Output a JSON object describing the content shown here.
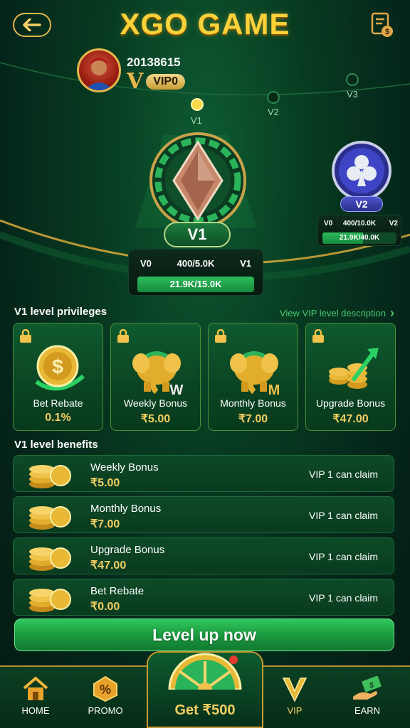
{
  "header": {
    "title": "XGO GAME",
    "back_icon": "arrow-left-icon",
    "record_icon": "bet-record-icon"
  },
  "user": {
    "id": "20138615",
    "vip_letter": "V",
    "vip_level": "VIP0"
  },
  "level_track": {
    "nodes": [
      "V1",
      "V2",
      "V3"
    ],
    "current": "V1"
  },
  "current_level_card": {
    "level": "V1",
    "from": "V0",
    "to": "V1",
    "exp_text": "400/5.0K",
    "bet_text": "21.9K/15.0K",
    "bet_progress": 1.0
  },
  "next_level_card": {
    "level": "V2",
    "from": "V0",
    "to": "V2",
    "exp_text": "400/10.0K",
    "bet_text": "21.9K/40.0K",
    "bet_progress": 0.55
  },
  "privileges": {
    "title": "V1 level privileges",
    "link_text": "View VIP level description",
    "cards": [
      {
        "name": "Bet Rebate",
        "value": "0.1%"
      },
      {
        "name": "Weekly Bonus",
        "value": "₹5.00",
        "letter": "W"
      },
      {
        "name": "Monthly Bonus",
        "value": "₹7.00",
        "letter": "M"
      },
      {
        "name": "Upgrade Bonus",
        "value": "₹47.00"
      }
    ]
  },
  "benefits": {
    "title": "V1 level benefits",
    "items": [
      {
        "name": "Weekly Bonus",
        "value": "₹5.00",
        "claim": "VIP 1 can claim"
      },
      {
        "name": "Monthly Bonus",
        "value": "₹7.00",
        "claim": "VIP 1 can claim"
      },
      {
        "name": "Upgrade Bonus",
        "value": "₹47.00",
        "claim": "VIP 1 can claim"
      },
      {
        "name": "Bet Rebate",
        "value": "₹0.00",
        "claim": "VIP 1 can claim"
      }
    ]
  },
  "level_up_button": "Level up now",
  "nav": {
    "home": "HOME",
    "promo": "PROMO",
    "get": "Get ₹500",
    "vip": "VIP",
    "earn": "EARN"
  },
  "colors": {
    "gold": "#f2cf61",
    "green_accent": "#45c870",
    "bg_dark": "#031b12"
  }
}
